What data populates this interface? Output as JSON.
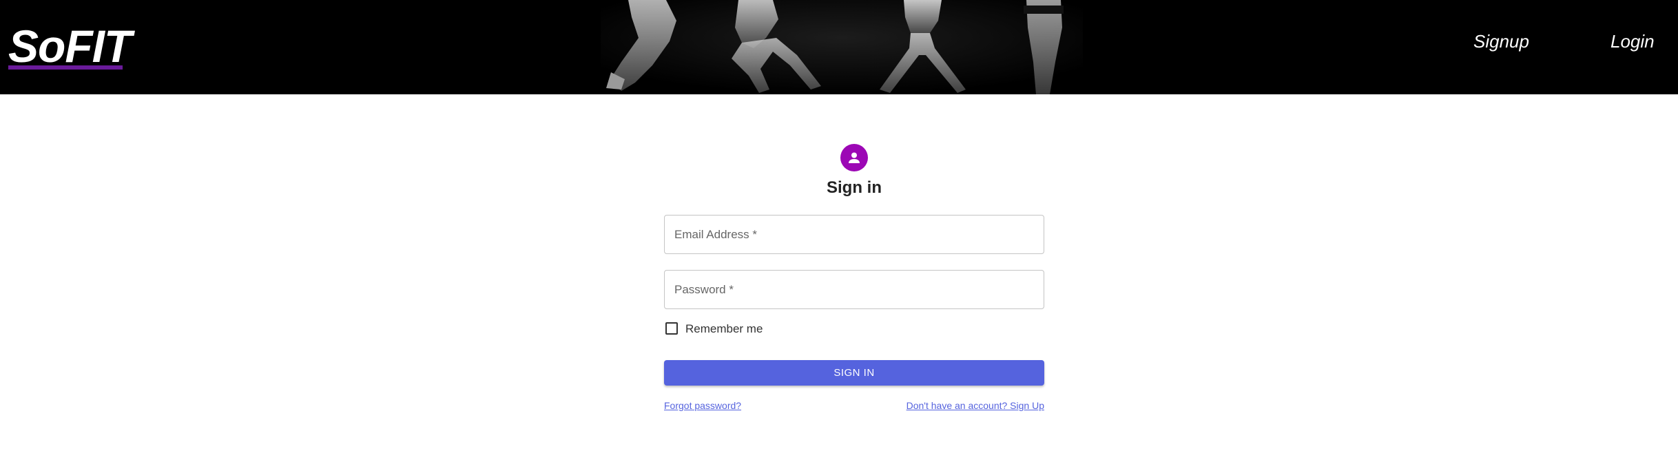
{
  "header": {
    "brand": "SoFIT",
    "nav": {
      "signup": "Signup",
      "login": "Login"
    }
  },
  "form": {
    "title": "Sign in",
    "email_placeholder": "Email Address *",
    "password_placeholder": "Password *",
    "remember_label": "Remember me",
    "remember_checked": false,
    "submit_label": "SIGN IN",
    "forgot_link": "Forgot password?",
    "signup_link": "Don't have an account? Sign Up"
  },
  "icons": {
    "avatar": "person-icon",
    "hero": "fitness-hero-image"
  },
  "colors": {
    "header_bg": "#000000",
    "brand_accent": "#6a1b9a",
    "avatar_bg": "#9c07b5",
    "primary": "#5563de"
  }
}
